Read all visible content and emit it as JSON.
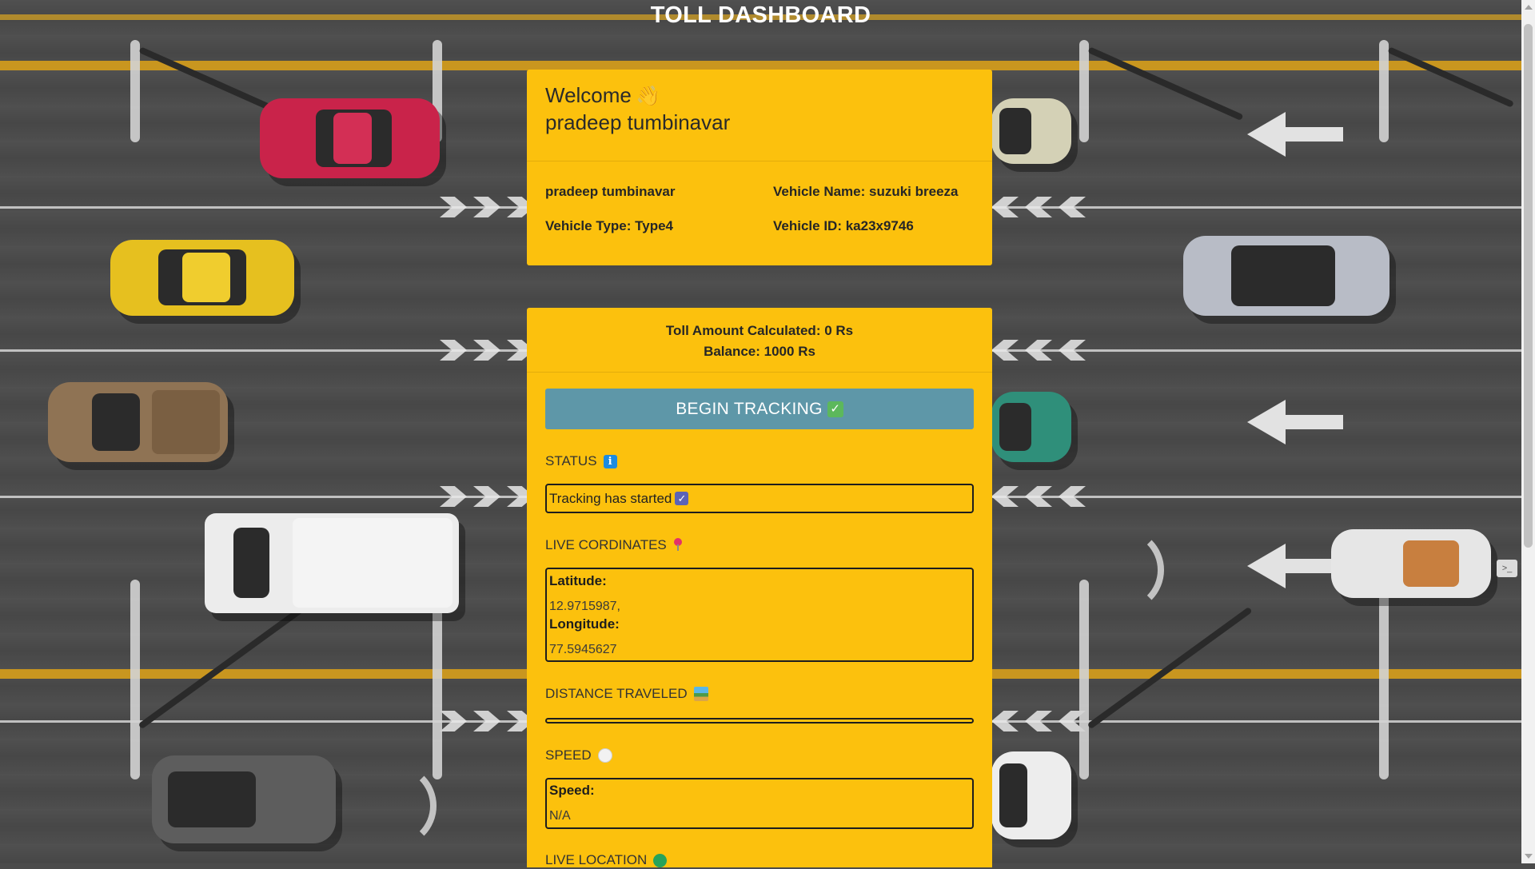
{
  "header": {
    "title": "TOLL DASHBOARD"
  },
  "welcome": {
    "greeting": "Welcome",
    "user_name": "pradeep tumbinavar",
    "info": {
      "name": "pradeep tumbinavar",
      "vehicle_name": "Vehicle Name: suzuki breeza",
      "vehicle_type": "Vehicle Type: Type4",
      "vehicle_id": "Vehicle ID: ka23x9746"
    }
  },
  "toll": {
    "amount": "Toll Amount Calculated: 0 Rs",
    "balance": "Balance: 1000 Rs",
    "track_button": "BEGIN TRACKING"
  },
  "status": {
    "label": "STATUS",
    "value": "Tracking has started"
  },
  "coordinates": {
    "label": "LIVE CORDINATES",
    "latitude_label": "Latitude:",
    "latitude_value": "12.9715987,",
    "longitude_label": "Longitude:",
    "longitude_value": "77.5945627"
  },
  "distance": {
    "label": "DISTANCE TRAVELED"
  },
  "speed": {
    "label": "SPEED",
    "field_label": "Speed:",
    "value": "N/A"
  },
  "live_location": {
    "label": "LIVE LOCATION"
  },
  "icons": {
    "wave": "waving-hand-icon",
    "check": "check-mark-icon",
    "info": "info-icon",
    "pin": "round-pushpin-icon",
    "map": "map-icon",
    "gauge": "speed-gauge-icon",
    "globe": "globe-icon"
  },
  "colors": {
    "card": "#fcc10d",
    "button": "#5e97a8",
    "road": "#4b4b4b"
  }
}
